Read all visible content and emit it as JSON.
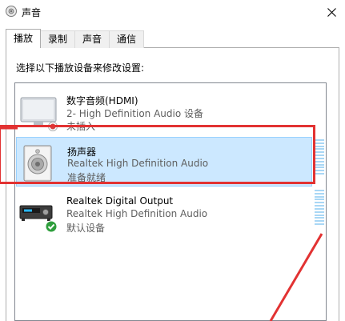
{
  "window": {
    "title": "声音",
    "close_icon": "close-icon"
  },
  "tabs": [
    {
      "label": "播放",
      "active": true
    },
    {
      "label": "录制",
      "active": false
    },
    {
      "label": "声音",
      "active": false
    },
    {
      "label": "通信",
      "active": false
    }
  ],
  "instruction": "选择以下播放设备来修改设置:",
  "devices": [
    {
      "name": "数字音频(HDMI)",
      "description": "2- High Definition Audio 设备",
      "status": "未插入",
      "icon": "monitor-icon",
      "badge": "unplugged-badge-icon",
      "selected": false
    },
    {
      "name": "扬声器",
      "description": "Realtek High Definition Audio",
      "status": "准备就绪",
      "icon": "speaker-icon",
      "selected": true
    },
    {
      "name": "Realtek Digital Output",
      "description": "Realtek High Definition Audio",
      "status": "默认设备",
      "icon": "digital-output-icon",
      "badge": "default-check-icon",
      "selected": false
    }
  ],
  "colors": {
    "selection": "#cce8ff",
    "selection_border": "#99d1ff",
    "annotation": "#e23232",
    "meter": "#a9d7f5"
  }
}
